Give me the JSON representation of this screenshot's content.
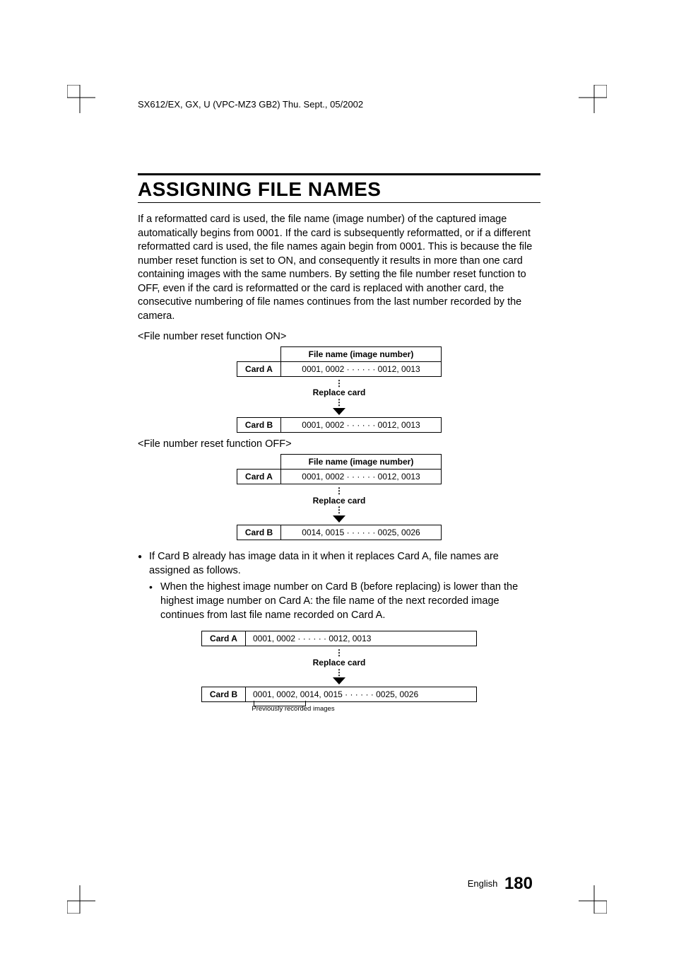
{
  "header": "SX612/EX, GX, U (VPC-MZ3 GB2)    Thu. Sept., 05/2002",
  "title": "ASSIGNING FILE NAMES",
  "intro": "If a reformatted card is used, the file name (image number) of the captured image automatically begins from 0001. If the card is subsequently reformatted, or if a different reformatted card is used, the file names again begin from 0001. This is because the file number reset function is set to ON, and consequently it results in more than one card containing images with the same numbers. By setting the file number reset function to OFF, even if the card is reformatted or the card is replaced with another card, the consecutive numbering of file names continues from the last number recorded by the camera.",
  "section_on_label": "<File number reset function ON>",
  "section_off_label": "<File number reset function OFF>",
  "col_header": "File name (image number)",
  "card_a": "Card A",
  "card_b": "Card B",
  "seq1": "0001, 0002 · · · · · · 0012, 0013",
  "seq_off_b": "0014, 0015 · · · · · · 0025, 0026",
  "replace": "Replace card",
  "bullet1": "If Card B already has image data in it when it replaces Card A, file names are assigned as follows.",
  "bullet2": "When the highest image number on Card B (before replacing) is lower than the highest image number on Card A: the file name of the next recorded image continues from last file name recorded on Card A.",
  "wide_b": "0001, 0002, 0014, 0015 · · · · · · 0025, 0026",
  "prev_rec": "Previously recorded images",
  "footer_lang": "English",
  "footer_page": "180",
  "chart_data": [
    {
      "type": "table",
      "title": "File number reset function ON",
      "columns": [
        "Card",
        "File name (image number)"
      ],
      "rows": [
        [
          "Card A",
          "0001, 0002 … 0012, 0013"
        ],
        [
          "Card B",
          "0001, 0002 … 0012, 0013"
        ]
      ],
      "note": "Replace card between A and B"
    },
    {
      "type": "table",
      "title": "File number reset function OFF",
      "columns": [
        "Card",
        "File name (image number)"
      ],
      "rows": [
        [
          "Card A",
          "0001, 0002 … 0012, 0013"
        ],
        [
          "Card B",
          "0014, 0015 … 0025, 0026"
        ]
      ],
      "note": "Replace card between A and B"
    },
    {
      "type": "table",
      "title": "Card B with pre-existing data (OFF)",
      "columns": [
        "Card",
        "File name (image number)"
      ],
      "rows": [
        [
          "Card A",
          "0001, 0002 … 0012, 0013"
        ],
        [
          "Card B",
          "0001, 0002, 0014, 0015 … 0025, 0026"
        ]
      ],
      "note": "0001, 0002 are previously recorded images"
    }
  ]
}
